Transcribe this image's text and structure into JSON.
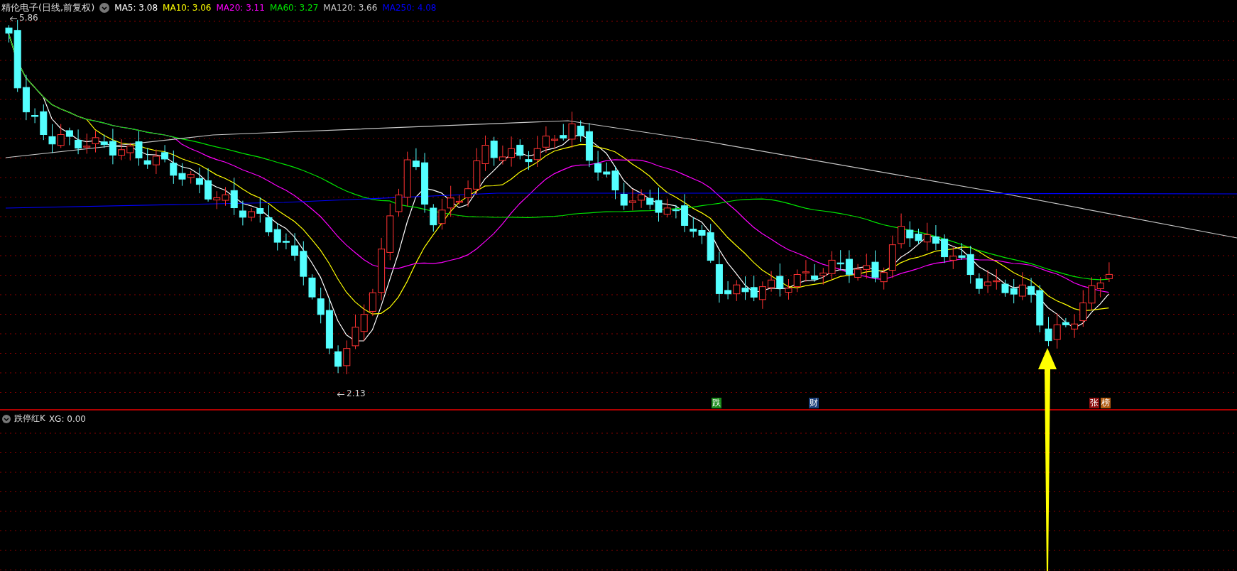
{
  "stock": {
    "name": "精伦电子(日线,前复权)"
  },
  "ma_legend": [
    {
      "label": "MA5: 3.08",
      "color": "#ffffff"
    },
    {
      "label": "MA10: 3.06",
      "color": "#ffff00"
    },
    {
      "label": "MA20: 3.11",
      "color": "#ff00ff"
    },
    {
      "label": "MA60: 3.27",
      "color": "#00e600"
    },
    {
      "label": "MA120: 3.66",
      "color": "#c8c8c8"
    },
    {
      "label": "MA250: 4.08",
      "color": "#0000ff"
    }
  ],
  "price_labels": {
    "high": "5.86",
    "low": "2.13"
  },
  "event_tags": [
    {
      "label": "跌",
      "color": "#1a8a1a"
    },
    {
      "label": "财",
      "color": "#1a3f7a"
    },
    {
      "label": "张",
      "color": "#8b0f0f"
    },
    {
      "label": "榜",
      "color": "#b05a10"
    }
  ],
  "indicator": {
    "name": "跌停红K",
    "readout": "XG: 0.00"
  }
}
